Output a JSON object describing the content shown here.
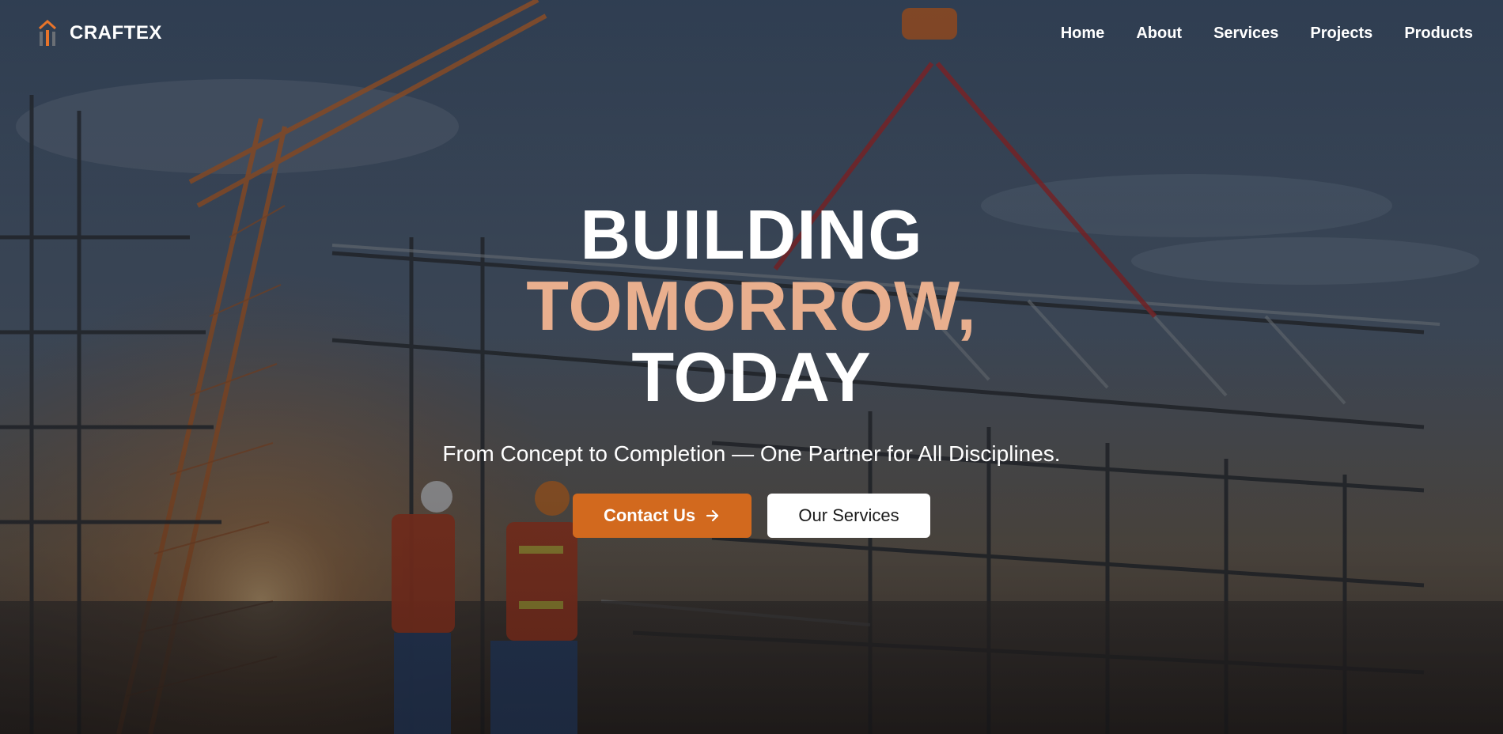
{
  "brand": {
    "name": "CRAFTEX",
    "icon": "building-columns-icon",
    "accent_color": "#e8742a"
  },
  "nav": {
    "items": [
      {
        "label": "Home"
      },
      {
        "label": "About"
      },
      {
        "label": "Services"
      },
      {
        "label": "Projects"
      },
      {
        "label": "Products"
      }
    ]
  },
  "hero": {
    "headline_line1": "BUILDING",
    "headline_line2": "TOMORROW,",
    "headline_line3": "TODAY",
    "accent_color": "#e9af8e",
    "subtitle": "From Concept to Completion — One Partner for All Disciplines.",
    "primary_button": {
      "label": "Contact Us",
      "icon": "arrow-right-icon",
      "color": "#d2691e"
    },
    "secondary_button": {
      "label": "Our Services",
      "color": "#ffffff"
    },
    "background": "construction-site-photo"
  }
}
